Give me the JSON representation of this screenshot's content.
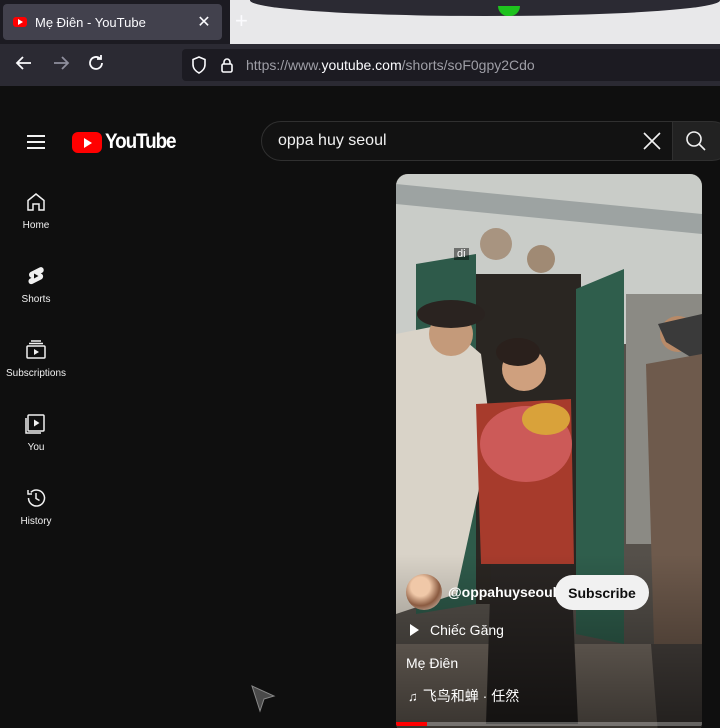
{
  "browser": {
    "tab_title": "Mẹ Điên - YouTube",
    "tab_close": "✕",
    "new_tab": "+",
    "url_prefix": "https://www.",
    "url_host": "youtube.com",
    "url_path": "/shorts/soF0gpy2Cdo"
  },
  "youtube": {
    "logo_text": "YouTube",
    "search_query": "oppa huy seoul",
    "sidebar": [
      {
        "label": "Home",
        "icon": "home-icon"
      },
      {
        "label": "Shorts",
        "icon": "shorts-icon"
      },
      {
        "label": "Subscriptions",
        "icon": "subscriptions-icon"
      },
      {
        "label": "You",
        "icon": "you-icon"
      },
      {
        "label": "History",
        "icon": "history-icon"
      }
    ]
  },
  "short": {
    "overlay_caption": "di",
    "channel_handle": "@oppahuyseoul",
    "subscribe_label": "Subscribe",
    "playlist": "Chiếc Găng",
    "title": "Mẹ Điên",
    "music": "飞鸟和蝉 · 任然",
    "progress_fraction": 0.1
  },
  "colors": {
    "brand_red": "#ff0000",
    "background": "#0f0f0f"
  }
}
